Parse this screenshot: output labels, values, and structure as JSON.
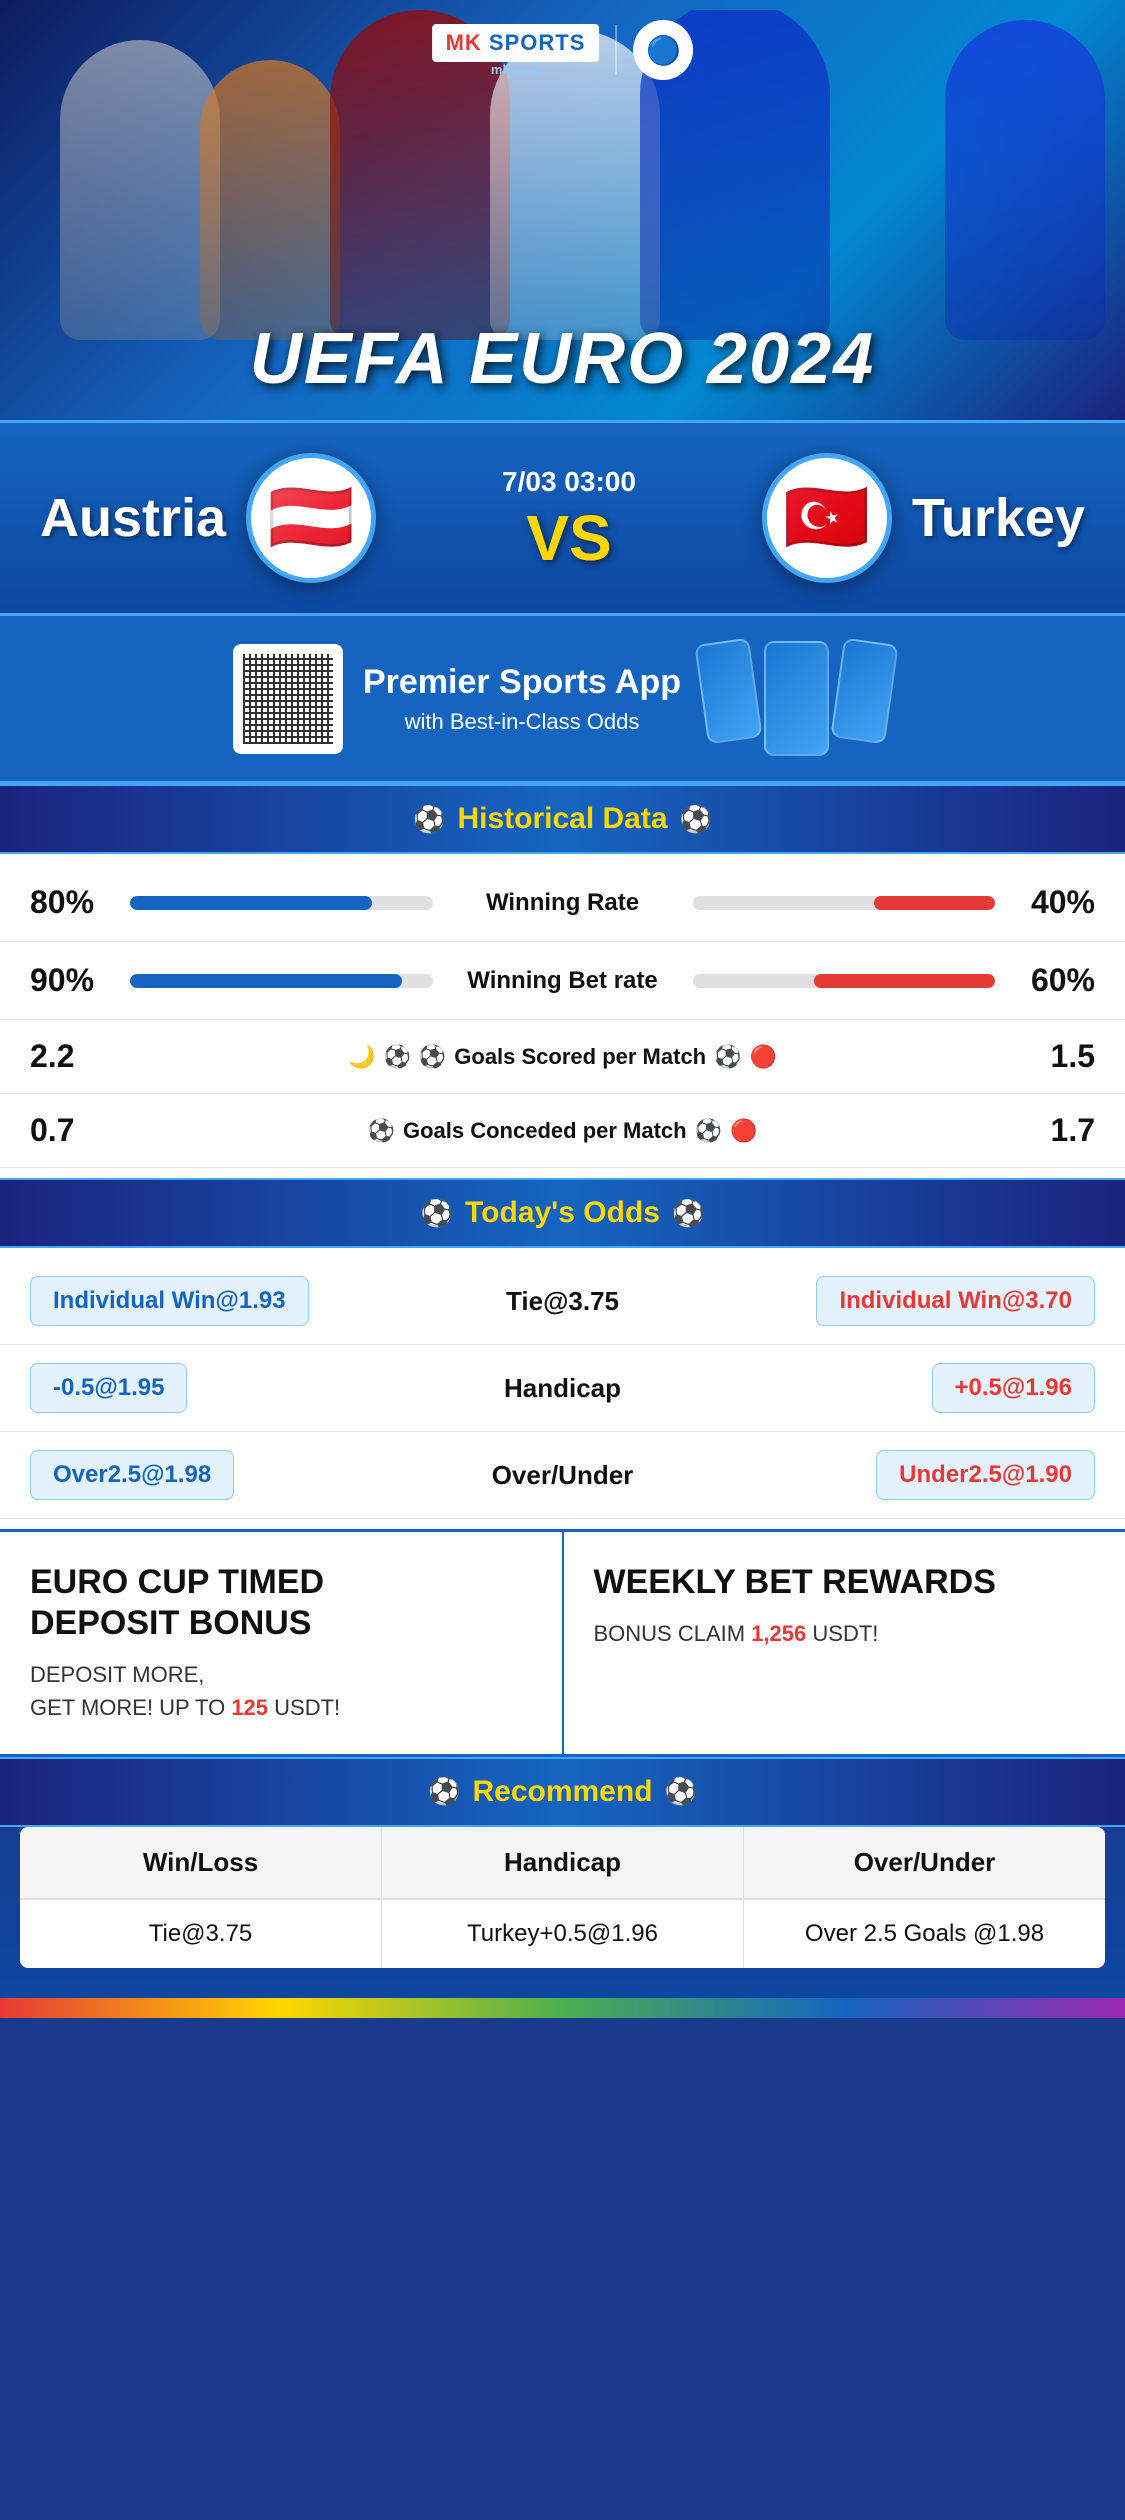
{
  "brand": {
    "name": "MK SPORTS",
    "url": "mk.com",
    "logo_text": "MK SPORTS"
  },
  "hero": {
    "title": "UEFA EURO 2024",
    "club_emoji": "🔵"
  },
  "match": {
    "team_left": "Austria",
    "team_right": "Turkey",
    "flag_left": "🇦🇹",
    "flag_right": "🇹🇷",
    "date": "7/03 03:00",
    "vs": "VS"
  },
  "promo": {
    "title": "Premier Sports App",
    "subtitle": "with Best-in-Class Odds"
  },
  "historical": {
    "section_title": "Historical Data",
    "stats": [
      {
        "label": "Winning Rate",
        "left_val": "80%",
        "right_val": "40%",
        "left_pct": 80,
        "right_pct": 40
      },
      {
        "label": "Winning Bet rate",
        "left_val": "90%",
        "right_val": "60%",
        "left_pct": 90,
        "right_pct": 60
      }
    ],
    "goals": [
      {
        "label": "Goals Scored per Match",
        "left_val": "2.2",
        "right_val": "1.5"
      },
      {
        "label": "Goals Conceded per Match",
        "left_val": "0.7",
        "right_val": "1.7"
      }
    ]
  },
  "odds": {
    "section_title": "Today's Odds",
    "rows": [
      {
        "left": "Individual Win@1.93",
        "center": "Tie@3.75",
        "right": "Individual Win@3.70",
        "left_color": "blue",
        "right_color": "red"
      },
      {
        "left": "-0.5@1.95",
        "center": "Handicap",
        "right": "+0.5@1.96",
        "left_color": "blue",
        "right_color": "red"
      },
      {
        "left": "Over2.5@1.98",
        "center": "Over/Under",
        "right": "Under2.5@1.90",
        "left_color": "blue",
        "right_color": "red"
      }
    ]
  },
  "bonus": {
    "left_title": "EURO CUP TIMED DEPOSIT BONUS",
    "left_desc1": "DEPOSIT MORE,",
    "left_desc2": "GET MORE! UP TO",
    "left_amount": "125",
    "left_currency": "USDT!",
    "right_title": "WEEKLY BET REWARDS",
    "right_desc": "BONUS CLAIM",
    "right_amount": "1,256",
    "right_currency": "USDT!"
  },
  "recommend": {
    "section_title": "Recommend",
    "columns": [
      "Win/Loss",
      "Handicap",
      "Over/Under"
    ],
    "values": [
      "Tie@3.75",
      "Turkey+0.5@1.96",
      "Over 2.5 Goals @1.98"
    ]
  }
}
